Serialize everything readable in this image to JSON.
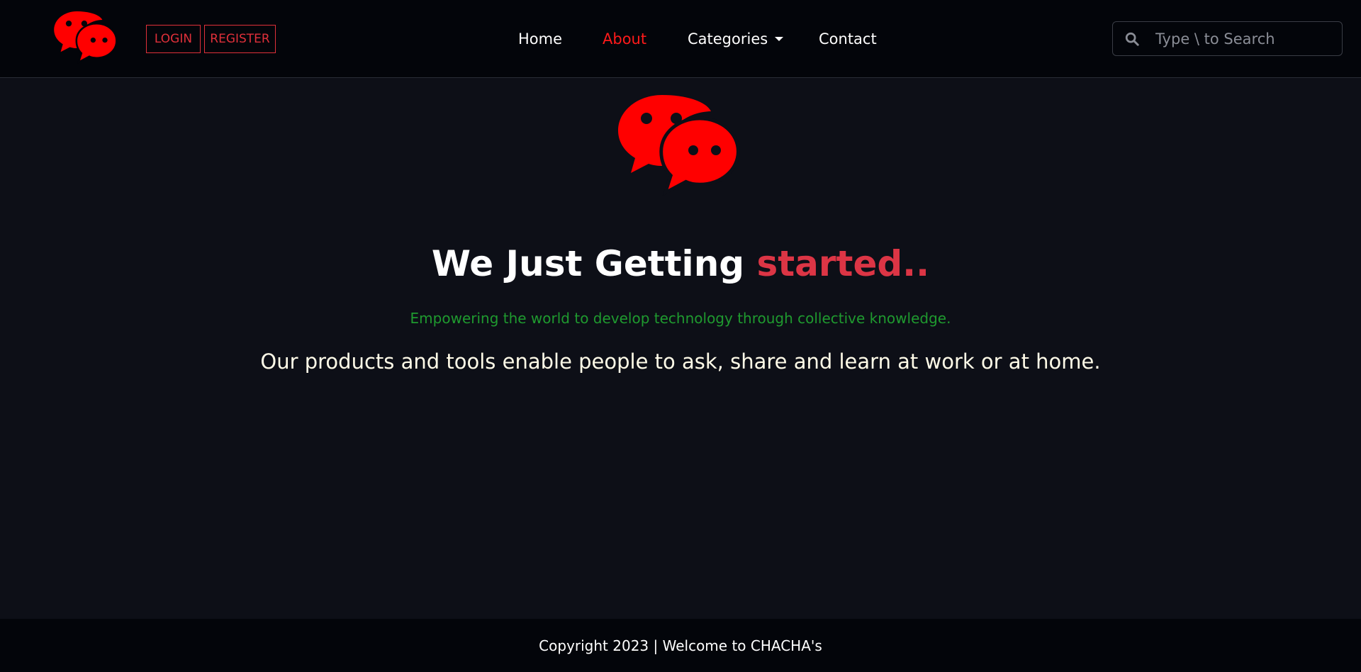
{
  "header": {
    "logo_icon": "chat-bubbles-icon",
    "login_label": "LOGIN",
    "register_label": "REGISTER",
    "nav": {
      "home": "Home",
      "about": "About",
      "categories": "Categories",
      "contact": "Contact"
    },
    "active_nav": "About",
    "search": {
      "placeholder": "Type \\ to Search",
      "icon": "search-icon"
    }
  },
  "hero": {
    "logo_icon": "chat-bubbles-icon",
    "headline_main": "We Just Getting ",
    "headline_accent": "started..",
    "tagline": "Empowering the world to develop technology through collective knowledge.",
    "lead": "Our products and tools enable people to ask, share and learn at work or at home."
  },
  "footer": {
    "text": "Copyright 2023 | Welcome to CHACHA's"
  },
  "colors": {
    "background": "#0d0f17",
    "navbar": "#03050a",
    "brand_red": "#ff0000",
    "accent_red": "#dc3545",
    "tagline_green": "#1f9a2f",
    "lead_text": "#fffbe8"
  }
}
